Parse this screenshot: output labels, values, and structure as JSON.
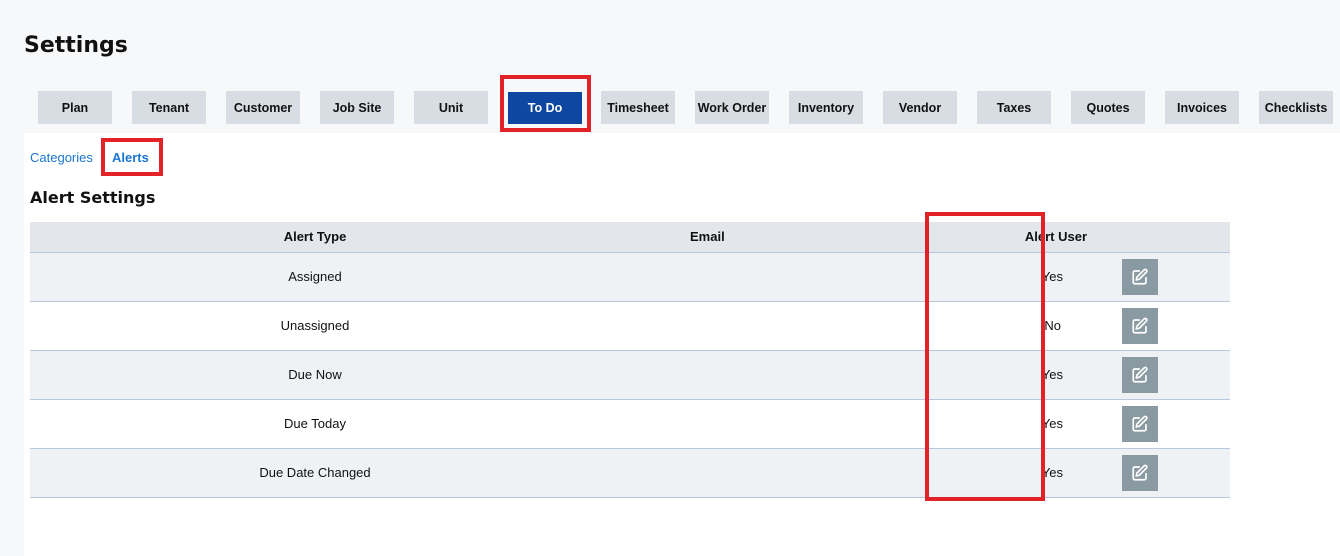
{
  "page": {
    "title": "Settings"
  },
  "tabs": [
    {
      "label": "Plan"
    },
    {
      "label": "Tenant"
    },
    {
      "label": "Customer"
    },
    {
      "label": "Job Site"
    },
    {
      "label": "Unit"
    },
    {
      "label": "To Do",
      "active": true
    },
    {
      "label": "Timesheet"
    },
    {
      "label": "Work Order"
    },
    {
      "label": "Inventory"
    },
    {
      "label": "Vendor"
    },
    {
      "label": "Taxes"
    },
    {
      "label": "Quotes"
    },
    {
      "label": "Invoices"
    },
    {
      "label": "Checklists"
    }
  ],
  "subtabs": {
    "categories": "Categories",
    "alerts": "Alerts"
  },
  "section": {
    "title": "Alert Settings"
  },
  "table": {
    "headers": {
      "alert_type": "Alert Type",
      "email": "Email",
      "alert_user": "Alert User"
    },
    "rows": [
      {
        "alert_type": "Assigned",
        "email": "",
        "alert_user": "Yes"
      },
      {
        "alert_type": "Unassigned",
        "email": "",
        "alert_user": "No"
      },
      {
        "alert_type": "Due Now",
        "email": "",
        "alert_user": "Yes"
      },
      {
        "alert_type": "Due Today",
        "email": "",
        "alert_user": "Yes"
      },
      {
        "alert_type": "Due Date Changed",
        "email": "",
        "alert_user": "Yes"
      }
    ]
  },
  "colors": {
    "accent": "#0d47a1",
    "link": "#1976d2",
    "highlight": "#e32227",
    "tab_bg": "#d7dde3",
    "edit_button": "#8a9aa3"
  },
  "icons": {
    "edit": "edit-icon"
  }
}
